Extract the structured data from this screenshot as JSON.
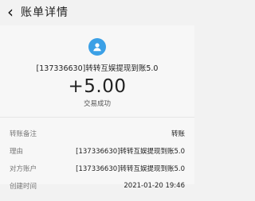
{
  "header": {
    "back_icon": "chevron-left-icon",
    "title": "账单详情"
  },
  "summary": {
    "avatar_icon": "user-icon",
    "counterparty": "[137336630]转转互娱提现到账5.0",
    "amount": "+5.00",
    "status": "交易成功"
  },
  "details": [
    {
      "label": "转账备注",
      "value": "转账"
    },
    {
      "label": "理由",
      "value": "[137336630]转转互娱提现到账5.0"
    },
    {
      "label": "对方账户",
      "value": "[137336630]转转互娱提现到账5.0"
    },
    {
      "label": "创建时间",
      "value": "2021-01-20 19:46"
    }
  ]
}
